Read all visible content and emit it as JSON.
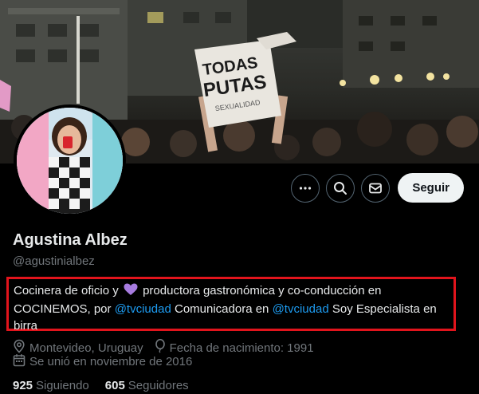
{
  "banner": {
    "protest_sign_text": "TODAS PUTAS"
  },
  "profile": {
    "display_name": "Agustina Albez",
    "handle": "@agustinialbez"
  },
  "actions": {
    "more_icon": "more-horizontal-icon",
    "search_icon": "search-icon",
    "message_icon": "envelope-icon",
    "follow_label": "Seguir"
  },
  "bio": {
    "part1": "Cocinera de oficio y",
    "emoji": "purple-heart",
    "part2": "productora gastronómica y co-conducción en COCINEMOS, por",
    "mention1": "@tvciudad",
    "part3": "Comunicadora en",
    "mention2": "@tvciudad",
    "part4": "Soy Especialista en birra"
  },
  "meta": {
    "location": "Montevideo, Uruguay",
    "birthday": "Fecha de nacimiento: 1991",
    "joined": "Se unió en noviembre de 2016"
  },
  "stats": {
    "following_count": "925",
    "following_label": "Siguiendo",
    "followers_count": "605",
    "followers_label": "Seguidores"
  },
  "colors": {
    "accent": "#1d9bf0",
    "highlight_border": "#e1141c",
    "heart": "#a77ce0"
  }
}
